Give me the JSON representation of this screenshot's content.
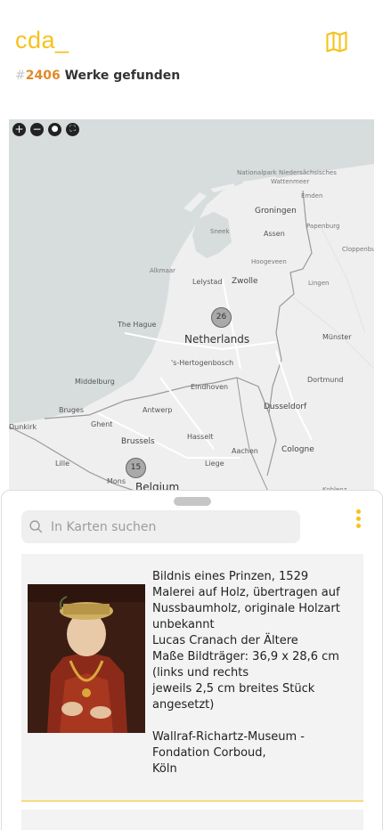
{
  "header": {
    "logo": "cda_",
    "hash": "#",
    "count": "2406",
    "count_suffix": " Werke gefunden"
  },
  "map": {
    "controls": [
      "zoom-in",
      "zoom-out",
      "locate",
      "fullscreen"
    ],
    "clusters": [
      {
        "name": "cluster-netherlands",
        "count": "26"
      },
      {
        "name": "cluster-belgium",
        "count": "15"
      }
    ],
    "labels": {
      "nationalpark": "Nationalpark Niedersächsisches",
      "wattenmeer": "Wattenmeer",
      "emden": "Emden",
      "groningen": "Groningen",
      "sneek": "Sneek",
      "assen": "Assen",
      "papenburg": "Papenburg",
      "cloppenburg": "Cloppenbur",
      "alkmaar": "Alkmaar",
      "hoogeveen": "Hoogeveen",
      "lelystad": "Lelystad",
      "zwolle": "Zwolle",
      "lingen": "Lingen",
      "thehague": "The Hague",
      "netherlands": "Netherlands",
      "munster": "Münster",
      "hertogenbosch": "'s-Hertogenbosch",
      "middelburg": "Middelburg",
      "eindhoven": "Eindhoven",
      "dortmund": "Dortmund",
      "bruges": "Bruges",
      "antwerp": "Antwerp",
      "dusseldorf": "Dusseldorf",
      "dunkirk": "Dunkirk",
      "ghent": "Ghent",
      "brussels": "Brussels",
      "hasselt": "Hasselt",
      "aachen": "Aachen",
      "cologne": "Cologne",
      "lille": "Lille",
      "liege": "Liege",
      "mons": "Mons",
      "belgium": "Belgium",
      "koblenz": "Koblenz"
    }
  },
  "sheet": {
    "search_placeholder": "In Karten suchen",
    "card": {
      "title": "Bildnis eines Prinzen, 1529",
      "lines": [
        "Malerei auf Holz, übertragen auf",
        "Nussbaumholz, originale Holzart",
        "unbekannt",
        "Lucas Cranach der Ältere",
        "Maße Bildträger: 36,9 x 28,6 cm",
        "(links und rechts",
        "jeweils 2,5 cm breites Stück",
        "angesetzt)"
      ],
      "museum": [
        "Wallraf-Richartz-Museum -",
        "Fondation Corboud,",
        "Köln"
      ]
    }
  },
  "colors": {
    "accent": "#f6c21b",
    "count": "#e08a2a",
    "sea": "#d7dcdd",
    "land": "#eeefee"
  }
}
